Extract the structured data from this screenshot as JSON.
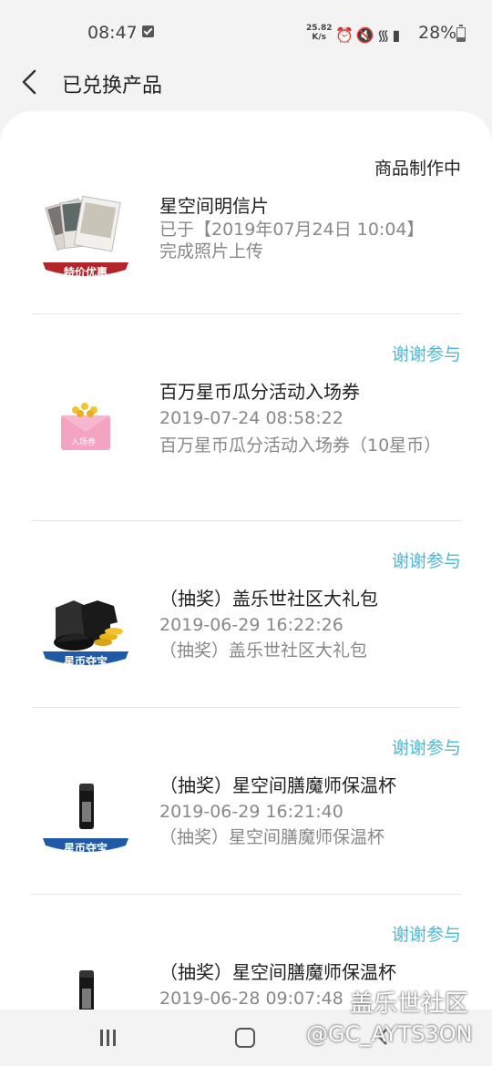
{
  "status_bar": {
    "time": "08:47",
    "speed_top": "25.82",
    "speed_bottom": "K/s",
    "icons": [
      "alarm-icon",
      "mute-icon",
      "wifi-icon",
      "signal-icon"
    ],
    "battery": "28%"
  },
  "header": {
    "title": "已兑换产品"
  },
  "items": [
    {
      "status": "商品制作中",
      "title": "星空间明信片",
      "line1": "已于【2019年07月24日 10:04】",
      "line2": "完成照片上传",
      "badge": "特价优惠"
    },
    {
      "status": "谢谢参与",
      "title": "百万星币瓜分活动入场券",
      "line1": "2019-07-24 08:58:22",
      "line2": "百万星币瓜分活动入场券（10星币）",
      "ticket_text": "入场券"
    },
    {
      "status": "谢谢参与",
      "title": "（抽奖）盖乐世社区大礼包",
      "line1": "2019-06-29 16:22:26",
      "line2": "（抽奖）盖乐世社区大礼包",
      "badge": "星币夺宝"
    },
    {
      "status": "谢谢参与",
      "title": "（抽奖）星空间膳魔师保温杯",
      "line1": "2019-06-29 16:21:40",
      "line2": "（抽奖）星空间膳魔师保温杯",
      "badge": "星币夺宝"
    },
    {
      "status": "谢谢参与",
      "title": "（抽奖）星空间膳魔师保温杯",
      "line1": "2019-06-28 09:07:48"
    }
  ],
  "watermark": {
    "line1": "盖乐世社区",
    "line2": "@GC_AYTS3ON"
  },
  "colors": {
    "accent": "#4fb8d4",
    "badge_red": "#b3252b",
    "badge_blue": "#1e5aa8"
  }
}
